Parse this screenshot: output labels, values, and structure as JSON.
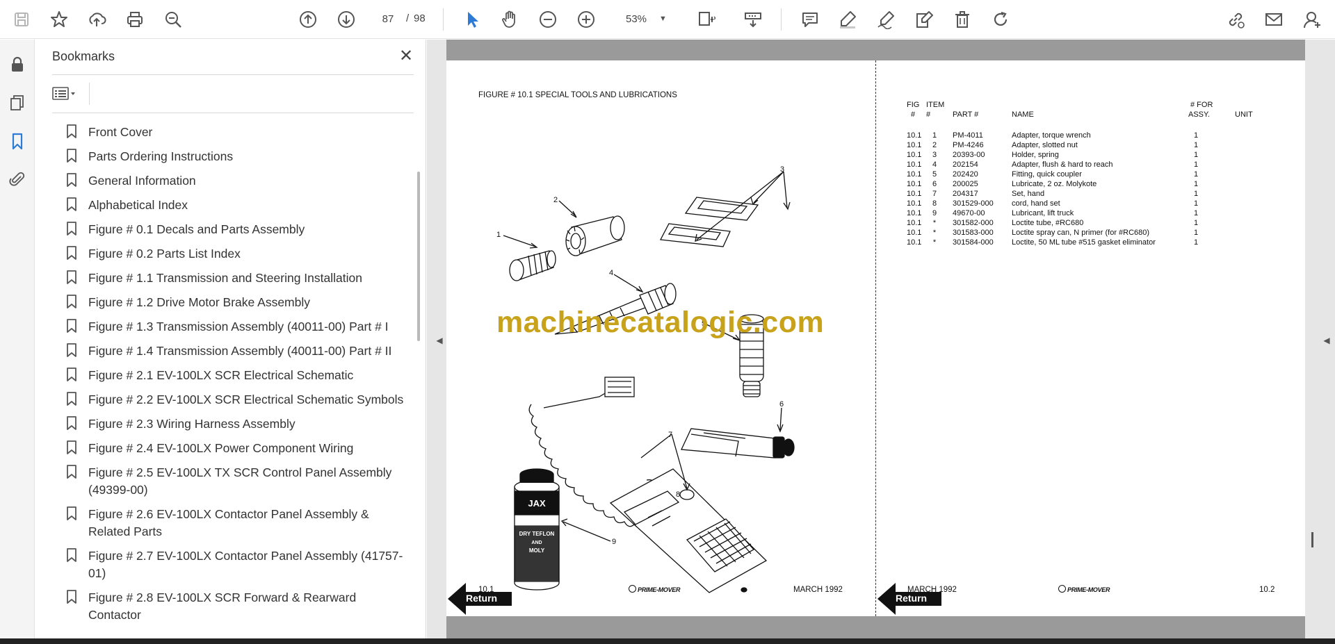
{
  "toolbar": {
    "icons": [
      "save-icon",
      "bookmark-star-icon",
      "upload-icon",
      "print-icon",
      "find-icon",
      "prev-page-icon",
      "next-page-icon",
      "select-cursor-icon",
      "hand-pan-icon",
      "zoom-out-icon",
      "zoom-in-icon",
      "fit-page-icon",
      "scroll-mode-icon",
      "comment-icon",
      "highlight-icon",
      "sign-icon",
      "edit-pdf-icon",
      "delete-icon",
      "rotate-icon",
      "share-link-icon",
      "email-icon",
      "account-icon"
    ],
    "page_current": "87",
    "page_separator": "/",
    "page_total": "98",
    "zoom": "53%"
  },
  "rail": {
    "icons": [
      "lock-icon",
      "pages-icon",
      "bookmarks-icon",
      "attachment-icon"
    ]
  },
  "bookmarks": {
    "title": "Bookmarks",
    "items": [
      "Front Cover",
      "Parts Ordering Instructions",
      "General Information",
      "Alphabetical Index",
      "Figure # 0.1 Decals and Parts Assembly",
      "Figure # 0.2 Parts List Index",
      "Figure # 1.1 Transmission and Steering Installation",
      "Figure # 1.2 Drive Motor Brake Assembly",
      "Figure # 1.3 Transmission Assembly (40011-00) Part # I",
      "Figure # 1.4 Transmission Assembly (40011-00) Part # II",
      "Figure # 2.1 EV-100LX SCR Electrical Schematic",
      "Figure # 2.2 EV-100LX SCR Electrical Schematic Symbols",
      "Figure # 2.3 Wiring Harness Assembly",
      "Figure # 2.4 EV-100LX Power Component Wiring",
      "Figure # 2.5 EV-100LX TX SCR Control Panel Assembly (49399-00)",
      "Figure # 2.6 EV-100LX Contactor Panel Assembly & Related Parts",
      "Figure # 2.7 EV-100LX Contactor Panel Assembly (41757-01)",
      "Figure # 2.8 EV-100LX SCR Forward & Rearward Contactor"
    ]
  },
  "document": {
    "figure_title": "FIGURE # 10.1 SPECIAL TOOLS AND LUBRICATIONS",
    "watermark": "machinecatalogic.com",
    "callouts": [
      "1",
      "2",
      "3",
      "4",
      "5",
      "6",
      "7",
      "8",
      "9"
    ],
    "illustration_text": {
      "jax": "JAX",
      "jax_line2": "DRY TEFLON",
      "jax_line3": "AND",
      "jax_line4": "MOLY"
    },
    "table": {
      "header_line1": {
        "fig": "FIG",
        "item": "ITEM",
        "qty": "# FOR"
      },
      "header_line2": {
        "fig": "#",
        "item": "#",
        "part": "PART #",
        "name": "NAME",
        "qty": "ASSY.",
        "unit": "UNIT"
      },
      "rows": [
        {
          "fig": "10.1",
          "item": "1",
          "part": "PM-4011",
          "name": "Adapter, torque wrench",
          "qty": "1"
        },
        {
          "fig": "10.1",
          "item": "2",
          "part": "PM-4246",
          "name": "Adapter, slotted nut",
          "qty": "1"
        },
        {
          "fig": "10.1",
          "item": "3",
          "part": "20393-00",
          "name": "Holder, spring",
          "qty": "1"
        },
        {
          "fig": "10.1",
          "item": "4",
          "part": "202154",
          "name": "Adapter, flush & hard to reach",
          "qty": "1"
        },
        {
          "fig": "10.1",
          "item": "5",
          "part": "202420",
          "name": "Fitting, quick coupler",
          "qty": "1"
        },
        {
          "fig": "10.1",
          "item": "6",
          "part": "200025",
          "name": "Lubricate, 2 oz. Molykote",
          "qty": "1"
        },
        {
          "fig": "10.1",
          "item": "7",
          "part": "204317",
          "name": "Set, hand",
          "qty": "1"
        },
        {
          "fig": "10.1",
          "item": "8",
          "part": "301529-000",
          "name": "cord, hand set",
          "qty": "1"
        },
        {
          "fig": "10.1",
          "item": "9",
          "part": "49670-00",
          "name": "Lubricant, lift truck",
          "qty": "1"
        },
        {
          "fig": "10.1",
          "item": "*",
          "part": "301582-000",
          "name": "Loctite tube, #RC680",
          "qty": "1"
        },
        {
          "fig": "10.1",
          "item": "*",
          "part": "301583-000",
          "name": "Loctite spray can, N primer (for #RC680)",
          "qty": "1"
        },
        {
          "fig": "10.1",
          "item": "*",
          "part": "301584-000",
          "name": "Loctite, 50 ML tube #515 gasket eliminator",
          "qty": "1"
        }
      ]
    },
    "footer_left": {
      "page": "10.1",
      "brand": "PRIME-MOVER",
      "date": "MARCH 1992",
      "return": "Return"
    },
    "footer_right": {
      "date": "MARCH 1992",
      "brand": "PRIME-MOVER",
      "page": "10.2",
      "return": "Return"
    }
  }
}
